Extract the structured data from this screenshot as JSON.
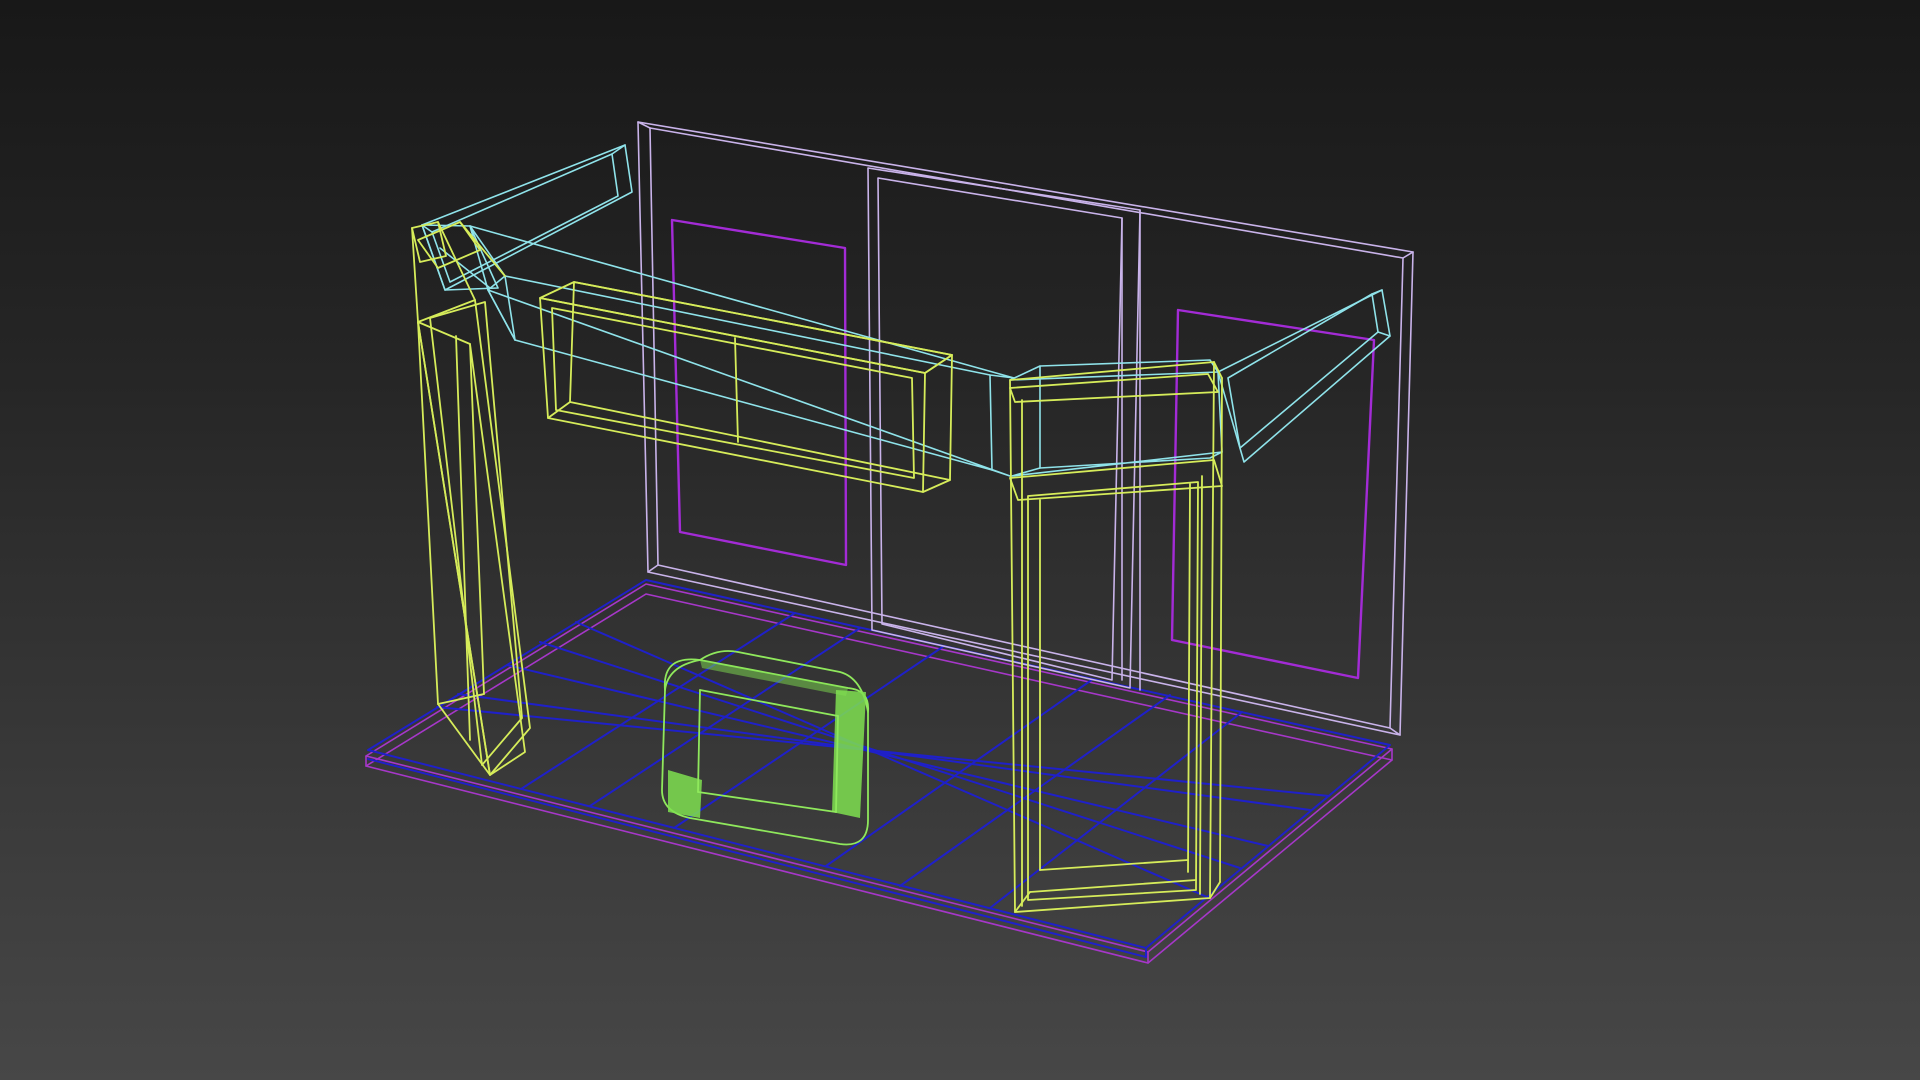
{
  "viewport": {
    "background_top": "#181818",
    "background_bottom": "#474747",
    "render_mode": "wireframe"
  },
  "objects": [
    {
      "name": "back-wall",
      "color": "#c9b3ea"
    },
    {
      "name": "top-frame-beam",
      "color": "#8fe3ea"
    },
    {
      "name": "left-pillar",
      "color": "#d6ec5a"
    },
    {
      "name": "right-pillar",
      "color": "#d6ec5a"
    },
    {
      "name": "front-header-box",
      "color": "#d6ec5a"
    },
    {
      "name": "wall-panel-left",
      "color": "#a32bd6"
    },
    {
      "name": "wall-panel-right",
      "color": "#a32bd6"
    },
    {
      "name": "floor-grid",
      "color": "#1f20c9"
    },
    {
      "name": "floor-base",
      "color": "#a637c9"
    },
    {
      "name": "selected-cube",
      "color": "#8fe85c",
      "selected": true
    }
  ]
}
